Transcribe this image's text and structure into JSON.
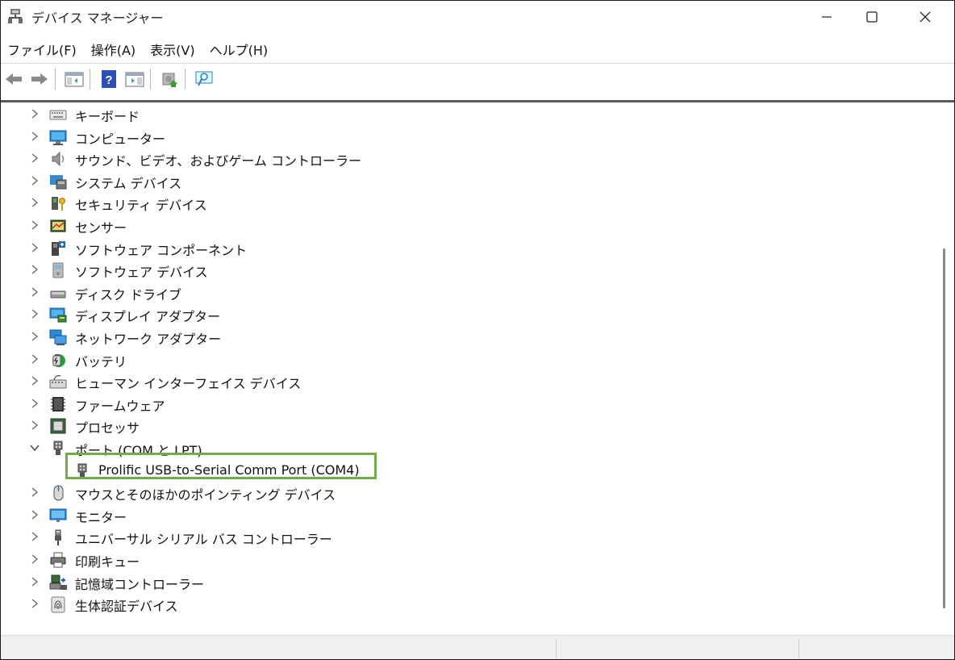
{
  "window": {
    "title": "デバイス マネージャー",
    "controls": {
      "minimize": "minimize",
      "maximize": "maximize",
      "close": "close"
    }
  },
  "menu": [
    "ファイル(F)",
    "操作(A)",
    "表示(V)",
    "ヘルプ(H)"
  ],
  "toolbar": [
    "back-arrow",
    "forward-arrow",
    "properties-panel",
    "help",
    "view-panel",
    "update-driver",
    "scan-hardware"
  ],
  "tree": {
    "items": [
      {
        "label": "キーボード",
        "icon": "keyboard-icon",
        "expanded": false
      },
      {
        "label": "コンピューター",
        "icon": "computer-icon",
        "expanded": false
      },
      {
        "label": "サウンド、ビデオ、およびゲーム コントローラー",
        "icon": "speaker-icon",
        "expanded": false
      },
      {
        "label": "システム デバイス",
        "icon": "system-device-icon",
        "expanded": false
      },
      {
        "label": "セキュリティ デバイス",
        "icon": "security-key-icon",
        "expanded": false
      },
      {
        "label": "センサー",
        "icon": "sensor-icon",
        "expanded": false
      },
      {
        "label": "ソフトウェア コンポーネント",
        "icon": "software-component-icon",
        "expanded": false
      },
      {
        "label": "ソフトウェア デバイス",
        "icon": "software-device-icon",
        "expanded": false
      },
      {
        "label": "ディスク ドライブ",
        "icon": "disk-drive-icon",
        "expanded": false
      },
      {
        "label": "ディスプレイ アダプター",
        "icon": "display-adapter-icon",
        "expanded": false
      },
      {
        "label": "ネットワーク アダプター",
        "icon": "network-adapter-icon",
        "expanded": false
      },
      {
        "label": "バッテリ",
        "icon": "battery-icon",
        "expanded": false
      },
      {
        "label": "ヒューマン インターフェイス デバイス",
        "icon": "hid-icon",
        "expanded": false
      },
      {
        "label": "ファームウェア",
        "icon": "firmware-icon",
        "expanded": false
      },
      {
        "label": "プロセッサ",
        "icon": "processor-icon",
        "expanded": false
      },
      {
        "label": "ポート (COM と LPT)",
        "icon": "port-icon",
        "expanded": true
      },
      {
        "label": "Prolific USB-to-Serial Comm Port (COM4)",
        "icon": "port-icon",
        "child": true,
        "highlighted": true
      },
      {
        "label": "マウスとそのほかのポインティング デバイス",
        "icon": "mouse-icon",
        "expanded": false
      },
      {
        "label": "モニター",
        "icon": "monitor-icon",
        "expanded": false
      },
      {
        "label": "ユニバーサル シリアル バス コントローラー",
        "icon": "usb-icon",
        "expanded": false
      },
      {
        "label": "印刷キュー",
        "icon": "printer-icon",
        "expanded": false
      },
      {
        "label": "記憶域コントローラー",
        "icon": "storage-controller-icon",
        "expanded": false
      },
      {
        "label": "生体認証デバイス",
        "icon": "biometric-icon",
        "expanded": false
      }
    ]
  },
  "colors": {
    "highlight_border": "#70ad47",
    "title_text": "#222222"
  }
}
